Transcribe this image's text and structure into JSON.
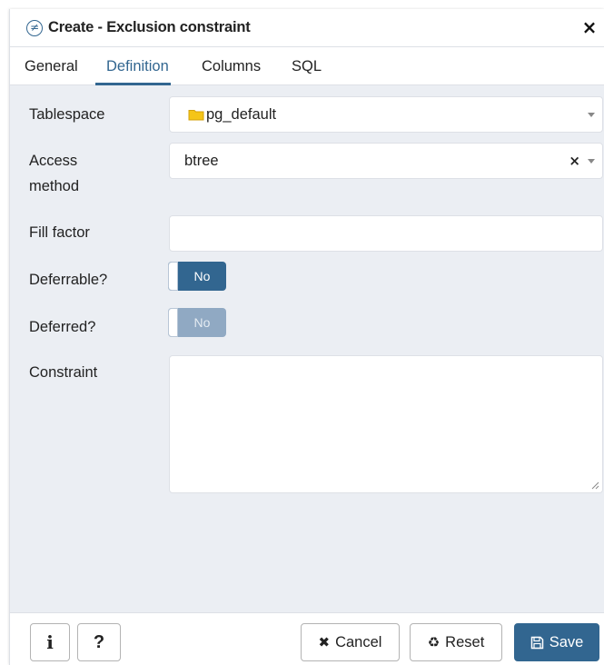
{
  "dialog": {
    "title": "Create - Exclusion constraint",
    "title_icon": "≠",
    "close_label": "×"
  },
  "tabs": [
    {
      "label": "General",
      "active": false
    },
    {
      "label": "Definition",
      "active": true
    },
    {
      "label": "Columns",
      "active": false
    },
    {
      "label": "SQL",
      "active": false
    }
  ],
  "form": {
    "tablespace": {
      "label": "Tablespace",
      "value": "pg_default"
    },
    "access_method": {
      "label_line1": "Access",
      "label_line2": "method",
      "value": "btree",
      "clear": "×"
    },
    "fill_factor": {
      "label": "Fill factor",
      "value": ""
    },
    "deferrable": {
      "label": "Deferrable?",
      "value": "No"
    },
    "deferred": {
      "label": "Deferred?",
      "value": "No"
    },
    "constraint": {
      "label": "Constraint",
      "value": ""
    }
  },
  "footer": {
    "info_label": "i",
    "help_label": "?",
    "cancel_label": "Cancel",
    "cancel_icon": "✖",
    "reset_label": "Reset",
    "reset_icon": "♻",
    "save_label": "Save"
  },
  "colors": {
    "accent": "#326690",
    "toggle_disabled": "#90a9c3",
    "panel_bg": "#ebeef3",
    "folder": "#f5c518"
  }
}
